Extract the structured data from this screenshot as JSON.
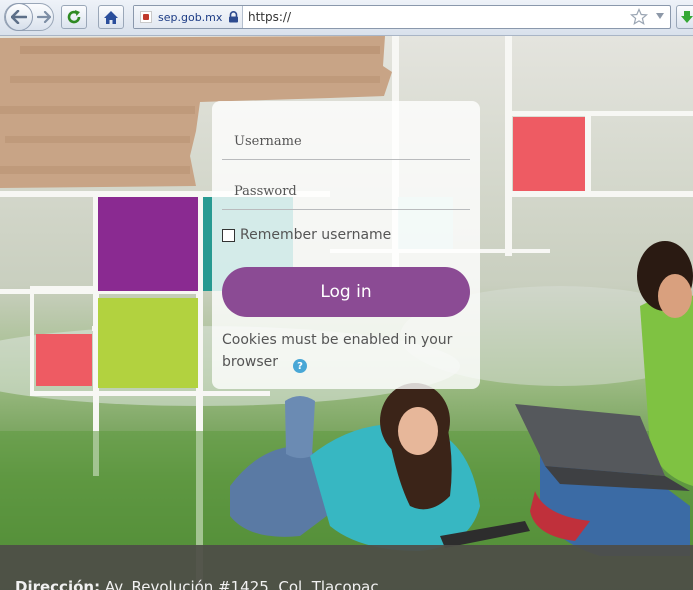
{
  "browser": {
    "identity": "sep.gob.mx",
    "url": "https://",
    "icons": {
      "back": "back-arrow-icon",
      "forward": "forward-arrow-icon",
      "reload": "reload-icon",
      "home": "home-icon",
      "site": "site-favicon",
      "lock": "lock-icon",
      "bookmark": "star-icon",
      "dropdown": "chevron-down-icon",
      "download": "download-icon"
    }
  },
  "login": {
    "username_placeholder": "Username",
    "password_placeholder": "Password",
    "remember_label": "Remember username",
    "remember_checked": false,
    "login_button": "Log in",
    "cookies_note": "Cookies must be enabled in your browser",
    "help_icon": "?"
  },
  "footer": {
    "label": "Dirección:",
    "address": "Av. Revolución #1425, Col. Tlacopac"
  },
  "colors": {
    "login_button": "#8b4b94",
    "help_icon": "#48a7d6",
    "footer_bg": "#4d4d47",
    "tile_purple": "#8a2a91",
    "tile_teal": "#0b8f88",
    "tile_red": "#ee5b63",
    "tile_lime": "#b2d23f",
    "redaction": "#c8a486"
  }
}
